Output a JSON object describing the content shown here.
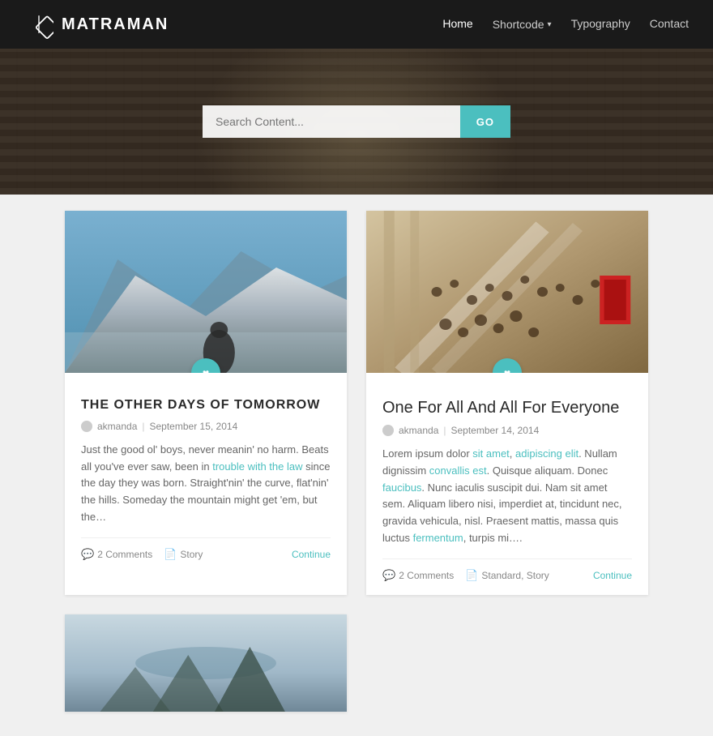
{
  "brand": {
    "name": "MATRAMAN"
  },
  "nav": {
    "home": "Home",
    "shortcode": "Shortcode",
    "typography": "Typography",
    "contact": "Contact"
  },
  "hero": {
    "search_placeholder": "Search Content...",
    "search_button": "GO"
  },
  "posts": [
    {
      "id": "post-1",
      "title": "THE OTHER DAYS OF TOMORROW",
      "title_style": "uppercase",
      "author": "akmanda",
      "date": "September 15, 2014",
      "excerpt": "Just the good ol' boys, never meanin' no harm. Beats all you've ever saw, been in trouble with the law since the day they was born. Straight'nin' the curve, flat'nin' the hills. Someday the mountain might get 'em, but the…",
      "comments": "2 Comments",
      "category": "Story",
      "continue": "Continue"
    },
    {
      "id": "post-2",
      "title": "One For All And All For Everyone",
      "title_style": "normal",
      "author": "akmanda",
      "date": "September 14, 2014",
      "excerpt": "Lorem ipsum dolor sit amet, adipiscing elit. Nullam dignissim convallis est. Quisque aliquam. Donec faucibus. Nunc iaculis suscipit dui. Nam sit amet sem. Aliquam libero nisi, imperdiet at, tincidunt nec, gravida vehicula, nisl. Praesent mattis, massa quis luctus fermentum, turpis mi….",
      "comments": "2 Comments",
      "category": "Standard, Story",
      "continue": "Continue"
    }
  ]
}
